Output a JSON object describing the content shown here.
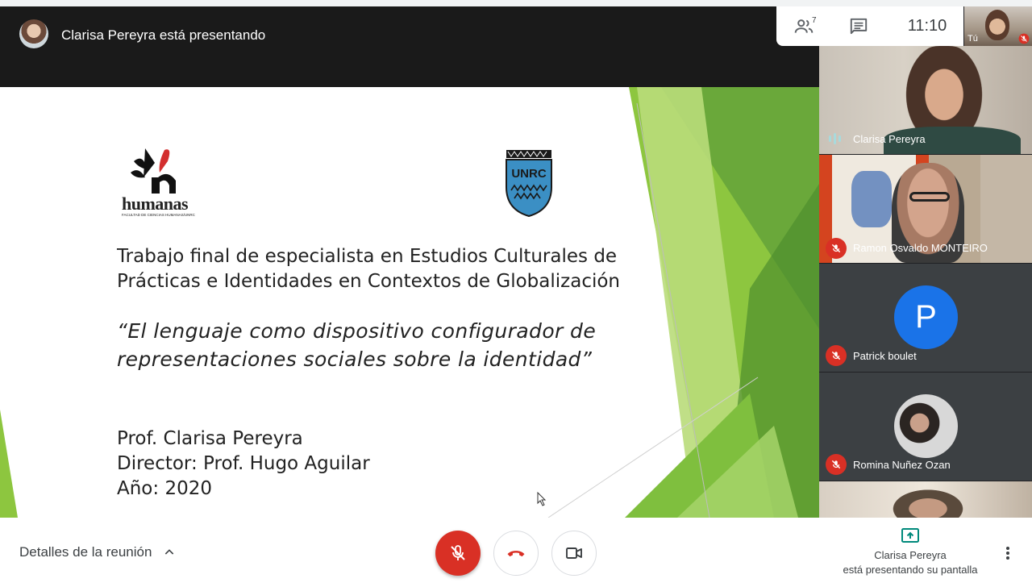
{
  "presenter": {
    "text": "Clarisa Pereyra está presentando"
  },
  "info_panel": {
    "participants_count": "7",
    "clock": "11:10"
  },
  "self_tile": {
    "label": "Tú"
  },
  "slide": {
    "logo_left_word": "humanas",
    "logo_left_sub": "FACULTAD DE CIENCIAS HUMANAS/UNRC",
    "logo_right_word": "UNRC",
    "title_lines": [
      "Trabajo final de especialista en Estudios Culturales de",
      "Prácticas e Identidades en Contextos de Globalización"
    ],
    "quote_lines": [
      "“El lenguaje como dispositivo configurador de",
      "representaciones sociales sobre la identidad”"
    ],
    "credit_lines": [
      "Prof. Clarisa Pereyra",
      "Director: Prof. Hugo Aguilar",
      "Año: 2020"
    ]
  },
  "participants": [
    {
      "name": "Clarisa Pereyra",
      "state": "speaking"
    },
    {
      "name": "Ramon Osvaldo MONTEIRO",
      "state": "muted"
    },
    {
      "name": "Patrick boulet",
      "state": "muted",
      "initial": "P",
      "avatar_color": "#1a73e8"
    },
    {
      "name": "Romina Nuñez Ozan",
      "state": "muted"
    },
    {
      "name": "",
      "state": "video"
    }
  ],
  "bottom_bar": {
    "details_label": "Detalles de la reunión",
    "share_name": "Clarisa Pereyra",
    "share_status": "está presentando su pantalla"
  },
  "colors": {
    "danger": "#d93025",
    "accent": "#00897b",
    "dark_bg": "#202124"
  },
  "icons": [
    "people-icon",
    "chat-icon",
    "mic-off-icon",
    "hang-up-icon",
    "camera-icon",
    "present-icon",
    "more-vert-icon",
    "chevron-up-icon",
    "speaking-icon"
  ]
}
